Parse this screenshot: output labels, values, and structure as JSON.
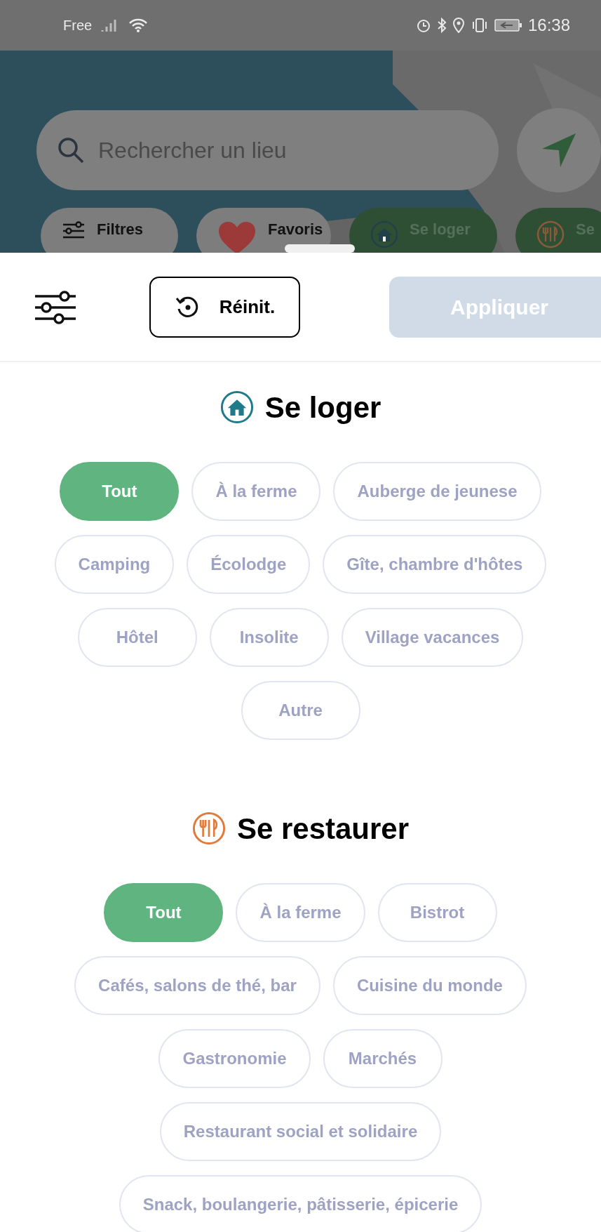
{
  "status_bar": {
    "carrier": "Free",
    "time": "16:38"
  },
  "search": {
    "placeholder": "Rechercher un lieu"
  },
  "map_chips": [
    {
      "label": "Filtres",
      "kind": "filters"
    },
    {
      "label": "Favoris",
      "kind": "favorites"
    },
    {
      "label": "Se loger",
      "kind": "lodging"
    },
    {
      "label": "Se",
      "kind": "food"
    }
  ],
  "toolbar": {
    "reset_label": "Réinit.",
    "apply_label": "Appliquer",
    "apply_disabled": true
  },
  "sections": [
    {
      "kind": "lodging",
      "title": "Se loger",
      "options": [
        {
          "label": "Tout",
          "selected": true
        },
        {
          "label": "À la ferme",
          "selected": false
        },
        {
          "label": "Auberge de jeunese",
          "selected": false
        },
        {
          "label": "Camping",
          "selected": false
        },
        {
          "label": "Écolodge",
          "selected": false
        },
        {
          "label": "Gîte, chambre d'hôtes",
          "selected": false
        },
        {
          "label": "Hôtel",
          "selected": false
        },
        {
          "label": "Insolite",
          "selected": false
        },
        {
          "label": "Village vacances",
          "selected": false
        },
        {
          "label": "Autre",
          "selected": false
        }
      ]
    },
    {
      "kind": "food",
      "title": "Se restaurer",
      "options": [
        {
          "label": "Tout",
          "selected": true
        },
        {
          "label": "À la ferme",
          "selected": false
        },
        {
          "label": "Bistrot",
          "selected": false
        },
        {
          "label": "Cafés, salons de thé, bar",
          "selected": false
        },
        {
          "label": "Cuisine du monde",
          "selected": false
        },
        {
          "label": "Gastronomie",
          "selected": false
        },
        {
          "label": "Marchés",
          "selected": false
        },
        {
          "label": "Restaurant social et solidaire",
          "selected": false
        },
        {
          "label": "Snack, boulangerie, pâtisserie, épicerie",
          "selected": false
        }
      ]
    }
  ]
}
